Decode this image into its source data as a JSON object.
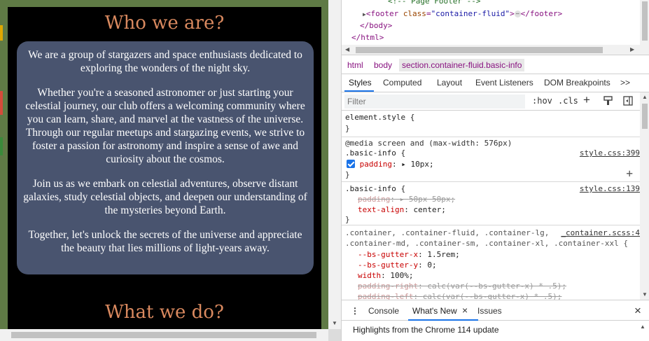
{
  "page": {
    "title_who": "Who we are?",
    "title_what": "What we do?",
    "paragraphs": [
      "We are a group of stargazers and space enthusiasts dedicated to exploring the wonders of the night sky.",
      "Whether you're a seasoned astronomer or just starting your celestial journey, our club offers a welcoming community where you can learn, share, and marvel at the vastness of the universe. Through our regular meetups and stargazing events, we strive to foster a passion for astronomy and inspire a sense of awe and curiosity about the cosmos.",
      "Join us as we embark on celestial adventures, observe distant galaxies, study celestial objects, and deepen our understanding of the mysteries beyond Earth.",
      "Together, let's unlock the secrets of the universe and appreciate the beauty that lies millions of light-years away."
    ],
    "colors": {
      "title": "#d9895f",
      "card": "#49546f",
      "background": "#000000",
      "frame": "#5f7a45"
    }
  },
  "devtools": {
    "tree": {
      "comment": "<!-- Page Footer -->",
      "footer_open": "<footer ",
      "footer_attr": "class",
      "footer_val": "\"container-fluid\"",
      "footer_close": "</footer>",
      "ellipsis": "⋯",
      "body_close": "</body>",
      "html_close": "</html>"
    },
    "breadcrumb": [
      "html",
      "body",
      "section.container-fluid.basic-info"
    ],
    "tabs": [
      "Styles",
      "Computed",
      "Layout",
      "Event Listeners",
      "DOM Breakpoints",
      ">>"
    ],
    "filter": {
      "placeholder": "Filter",
      "hov": ":hov",
      "cls": ".cls"
    },
    "rules": {
      "element_style": "element.style {",
      "close": "}",
      "media": "@media screen and (max-width: 576px)",
      "basic_info_sel": ".basic-info {",
      "src_399": "style.css:399",
      "padding_prop": "padding",
      "padding_val_10": "10px;",
      "src_139": "style.css:139",
      "padding_val_50": "50px 50px;",
      "text_align_prop": "text-align",
      "text_align_val": "center;",
      "container_sel_1": ".container, .container-fluid, .container-lg,",
      "container_sel_2": ".container-md, .container-sm, .container-xl, .container-xxl {",
      "src_scss": "_container.scss:4",
      "gx_prop": "--bs-gutter-x",
      "gx_val": "1.5rem;",
      "gy_prop": "--bs-gutter-y",
      "gy_val": "0;",
      "width_prop": "width",
      "width_val": "100%;",
      "pr_prop": "padding-right",
      "pr_val": "calc(var(--bs-gutter-x) * .5);",
      "pl_prop": "padding-left",
      "pl_val": "calc(var(--bs-gutter-x) * .5);"
    },
    "drawer": {
      "tabs": [
        "Console",
        "What's New",
        "Issues"
      ],
      "close_tab": "×",
      "close_drawer": "×",
      "content": "Highlights from the Chrome 114 update"
    }
  }
}
